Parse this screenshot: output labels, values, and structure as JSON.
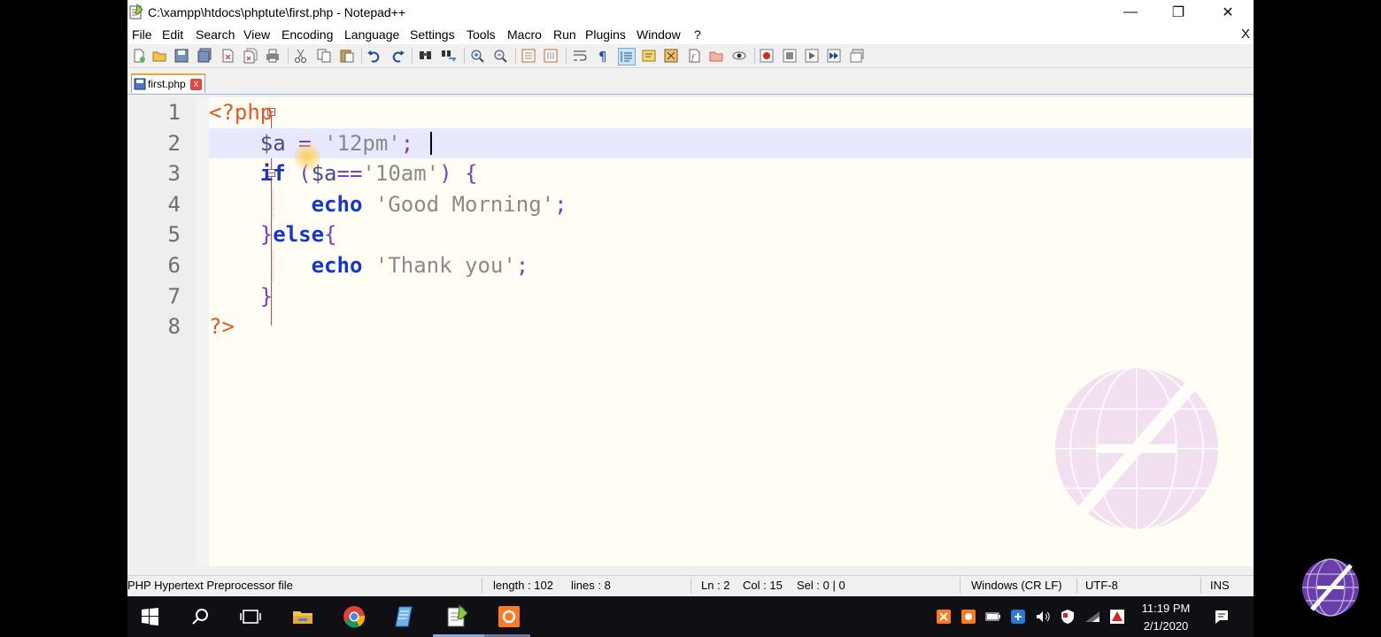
{
  "window": {
    "title": "C:\\xampp\\htdocs\\phptute\\first.php - Notepad++",
    "minimize_glyph": "—",
    "maximize_glyph": "❐",
    "close_glyph": "✕"
  },
  "menu": {
    "items": [
      "File",
      "Edit",
      "Search",
      "View",
      "Encoding",
      "Language",
      "Settings",
      "Tools",
      "Macro",
      "Run",
      "Plugins",
      "Window",
      "?"
    ],
    "close_label": "X"
  },
  "toolbar": {
    "icons": [
      "new-file-icon",
      "open-file-icon",
      "save-icon",
      "save-all-icon",
      "close-icon",
      "close-all-icon",
      "print-icon",
      "cut-icon",
      "copy-icon",
      "paste-icon",
      "undo-icon",
      "redo-icon",
      "find-icon",
      "replace-icon",
      "zoom-in-icon",
      "zoom-out-icon",
      "sync-vertical-icon",
      "sync-horizontal-icon",
      "word-wrap-icon",
      "show-all-characters-icon",
      "indent-guide-icon",
      "user-defined-language-icon",
      "document-map-icon",
      "function-list-icon",
      "folder-as-workspace-icon",
      "monitoring-icon",
      "record-macro-icon",
      "stop-recording-icon",
      "playback-macro-icon",
      "run-macro-multiple-icon",
      "save-macro-icon"
    ]
  },
  "tab": {
    "label": "first.php",
    "close_glyph": "x"
  },
  "editor": {
    "line_numbers": [
      "1",
      "2",
      "3",
      "4",
      "5",
      "6",
      "7",
      "8"
    ],
    "lines": [
      [
        {
          "t": "<?php",
          "c": "t-tag"
        }
      ],
      [
        {
          "t": "    ",
          "c": ""
        },
        {
          "t": "$a",
          "c": "t-var"
        },
        {
          "t": " = ",
          "c": "t-op"
        },
        {
          "t": "'12pm'",
          "c": "t-str"
        },
        {
          "t": ";",
          "c": "t-op"
        }
      ],
      [
        {
          "t": "    ",
          "c": ""
        },
        {
          "t": "if",
          "c": "t-kw"
        },
        {
          "t": " (",
          "c": "t-op"
        },
        {
          "t": "$a",
          "c": "t-var"
        },
        {
          "t": "==",
          "c": "t-op"
        },
        {
          "t": "'10am'",
          "c": "t-str"
        },
        {
          "t": ") {",
          "c": "t-op"
        }
      ],
      [
        {
          "t": "        ",
          "c": ""
        },
        {
          "t": "echo",
          "c": "t-kw"
        },
        {
          "t": " ",
          "c": ""
        },
        {
          "t": "'Good Morning'",
          "c": "t-str"
        },
        {
          "t": ";",
          "c": "t-op"
        }
      ],
      [
        {
          "t": "    ",
          "c": ""
        },
        {
          "t": "}",
          "c": "t-brace"
        },
        {
          "t": "else",
          "c": "t-kw"
        },
        {
          "t": "{",
          "c": "t-brace"
        }
      ],
      [
        {
          "t": "        ",
          "c": ""
        },
        {
          "t": "echo",
          "c": "t-kw"
        },
        {
          "t": " ",
          "c": ""
        },
        {
          "t": "'Thank you'",
          "c": "t-str"
        },
        {
          "t": ";",
          "c": "t-op"
        }
      ],
      [
        {
          "t": "    ",
          "c": ""
        },
        {
          "t": "}",
          "c": "t-brace"
        }
      ],
      [
        {
          "t": "?>",
          "c": "t-tag"
        }
      ]
    ]
  },
  "status": {
    "file_type": "PHP Hypertext Preprocessor file",
    "length": "length : 102",
    "lines": "lines : 8",
    "ln": "Ln : 2",
    "col": "Col : 15",
    "sel": "Sel : 0 | 0",
    "eol": "Windows (CR LF)",
    "encoding": "UTF-8",
    "mode": "INS"
  },
  "taskbar": {
    "icons": [
      "windows-start-icon",
      "search-icon",
      "task-view-icon",
      "file-explorer-icon",
      "chrome-icon",
      "notepad-icon",
      "notepad-plus-plus-icon",
      "xampp-icon"
    ],
    "tray_icons": [
      "xampp-tray-icon",
      "tray-app-icon",
      "battery-icon",
      "network-app-icon",
      "volume-icon",
      "security-icon",
      "wifi-icon",
      "tray-alert-icon"
    ],
    "time": "11:19 PM",
    "date": "2/1/2020"
  },
  "colors": {
    "current_line": "#e8e8ff",
    "keyword": "#1537c9",
    "php_tag": "#e05a26",
    "string": "#8a8a8a",
    "operator": "#7a40c0"
  }
}
